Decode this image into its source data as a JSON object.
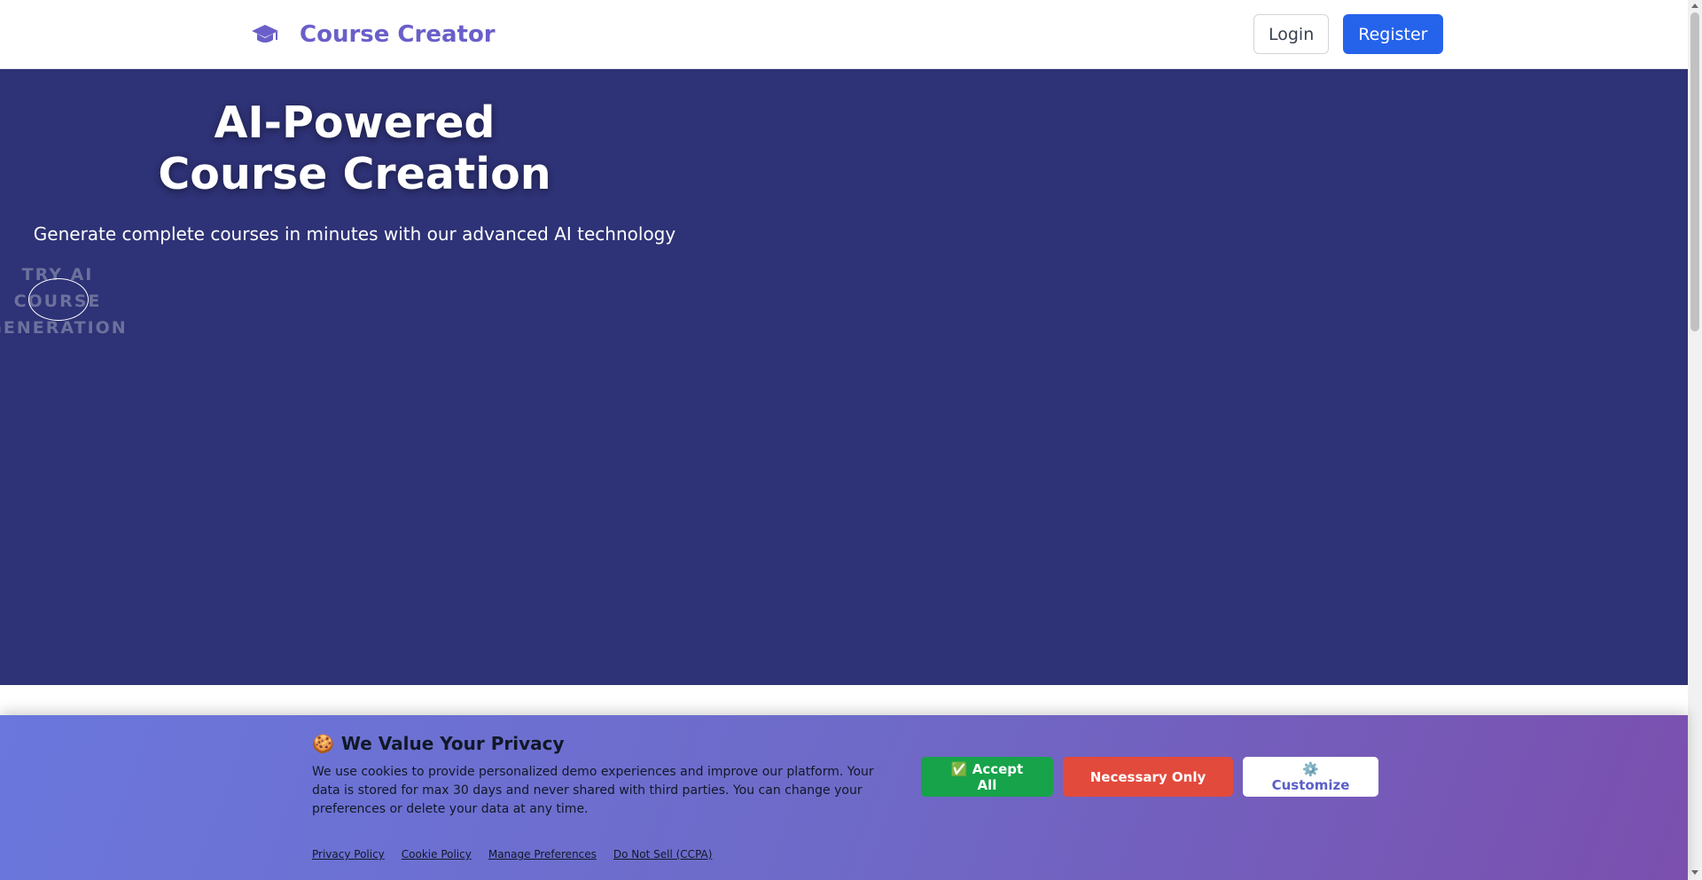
{
  "navbar": {
    "brand_icon": "graduation-cap-icon",
    "brand_name": "Course Creator",
    "login_label": "Login",
    "register_label": "Register"
  },
  "hero": {
    "title_line1": "AI-Powered",
    "title_line2": "Course Creation",
    "subtitle": "Generate complete courses in minutes with our advanced AI technology",
    "cta_line1": "TRY AI",
    "cta_line2": "COURSE",
    "cta_line3": "GENERATION"
  },
  "cookie_banner": {
    "icon": "cookie-icon",
    "title": "We Value Your Privacy",
    "text": "We use cookies to provide personalized demo experiences and improve our platform. Your data is stored for max 30 days and never shared with third parties. You can change your preferences or delete your data at any time.",
    "accept_label": "✅ Accept All",
    "necessary_label": "Necessary Only",
    "customize_label": "⚙️ Customize",
    "links": [
      "Privacy Policy",
      "Cookie Policy",
      "Manage Preferences",
      "Do Not Sell (CCPA)"
    ]
  },
  "colors": {
    "brand": "#6a5fc9",
    "primary": "#2563eb",
    "hero_bg": "#2e3276",
    "accept": "#16a34a",
    "necessary": "#e24a3c"
  }
}
